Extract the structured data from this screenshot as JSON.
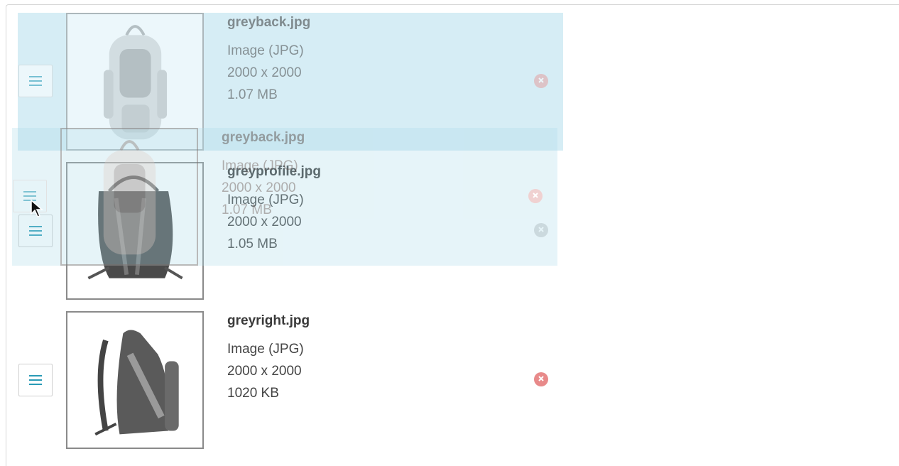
{
  "files": [
    {
      "name": "greyback.jpg",
      "type": "Image (JPG)",
      "dimensions": "2000 x 2000",
      "size": "1.07 MB"
    },
    {
      "name": "greyprofile.jpg",
      "type": "Image (JPG)",
      "dimensions": "2000 x 2000",
      "size": "1.05 MB"
    },
    {
      "name": "greyright.jpg",
      "type": "Image (JPG)",
      "dimensions": "2000 x 2000",
      "size": "1020 KB"
    }
  ],
  "drag_ghost": {
    "name": "greyback.jpg",
    "type": "Image (JPG)",
    "dimensions": "2000 x 2000",
    "size": "1.07 MB"
  },
  "colors": {
    "accent": "#2a9bb6",
    "remove": "#e88a8a",
    "ghost": "#b7e0ee",
    "border": "#cfcfcf"
  },
  "icons": {
    "handle": "drag-handle-icon",
    "remove": "remove-icon",
    "cursor": "mouse-pointer-icon"
  }
}
